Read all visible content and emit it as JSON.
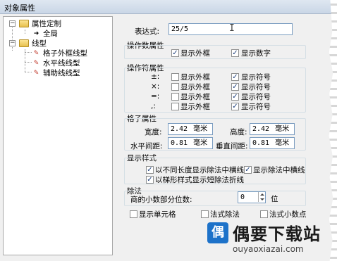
{
  "window": {
    "title": "对象属性"
  },
  "tree": {
    "items": [
      {
        "label": "属性定制",
        "expander": "−"
      },
      {
        "label": "全局"
      },
      {
        "label": "线型",
        "expander": "−"
      },
      {
        "label": "格子外框线型"
      },
      {
        "label": "水平线线型"
      },
      {
        "label": "辅助线线型"
      }
    ]
  },
  "expression": {
    "label": "表达式:",
    "value": "25/5"
  },
  "operand": {
    "header": "操作数属性",
    "show_border": {
      "label": "显示外框",
      "checked": true
    },
    "show_number": {
      "label": "显示数字",
      "checked": true
    }
  },
  "operator": {
    "header": "操作符属性",
    "rows": [
      {
        "symbol": "±:",
        "border_label": "显示外框",
        "border_checked": false,
        "symbol_label": "显示符号",
        "symbol_checked": true
      },
      {
        "symbol": "×:",
        "border_label": "显示外框",
        "border_checked": false,
        "symbol_label": "显示符号",
        "symbol_checked": true
      },
      {
        "symbol": "=:",
        "border_label": "显示外框",
        "border_checked": false,
        "symbol_label": "显示符号",
        "symbol_checked": true
      },
      {
        "symbol": ",:",
        "border_label": "显示外框",
        "border_checked": false,
        "symbol_label": "显示符号",
        "symbol_checked": true
      }
    ]
  },
  "grid": {
    "header": "格子属性",
    "width": {
      "label": "宽度:",
      "value": "2.42",
      "unit": "毫米"
    },
    "height": {
      "label": "高度:",
      "value": "2.42",
      "unit": "毫米"
    },
    "h_spacing": {
      "label": "水平间距:",
      "value": "0.81",
      "unit": "毫米"
    },
    "v_spacing": {
      "label": "垂直间距:",
      "value": "0.81",
      "unit": "毫米"
    }
  },
  "display": {
    "header": "显示样式",
    "opt1": {
      "label": "以不同长度显示除法中横线",
      "checked": true
    },
    "opt2": {
      "label": "显示除法中横线",
      "checked": true
    },
    "opt3": {
      "label": "以梯形样式显示短除法折线",
      "checked": true
    }
  },
  "division": {
    "header": "除法",
    "decimals_label": "商的小数部分位数:",
    "decimals_value": "0",
    "decimals_unit": "位"
  },
  "bottom": {
    "show_cells": {
      "label": "显示单元格",
      "checked": false
    },
    "vertical_division": {
      "label": "法式除法",
      "checked": false
    },
    "decimal_point": {
      "label": "法式小数点",
      "checked": false
    }
  },
  "watermark": {
    "mark": "偶",
    "title": "偶要下载站",
    "url": "ouyaoxiazai.com"
  }
}
